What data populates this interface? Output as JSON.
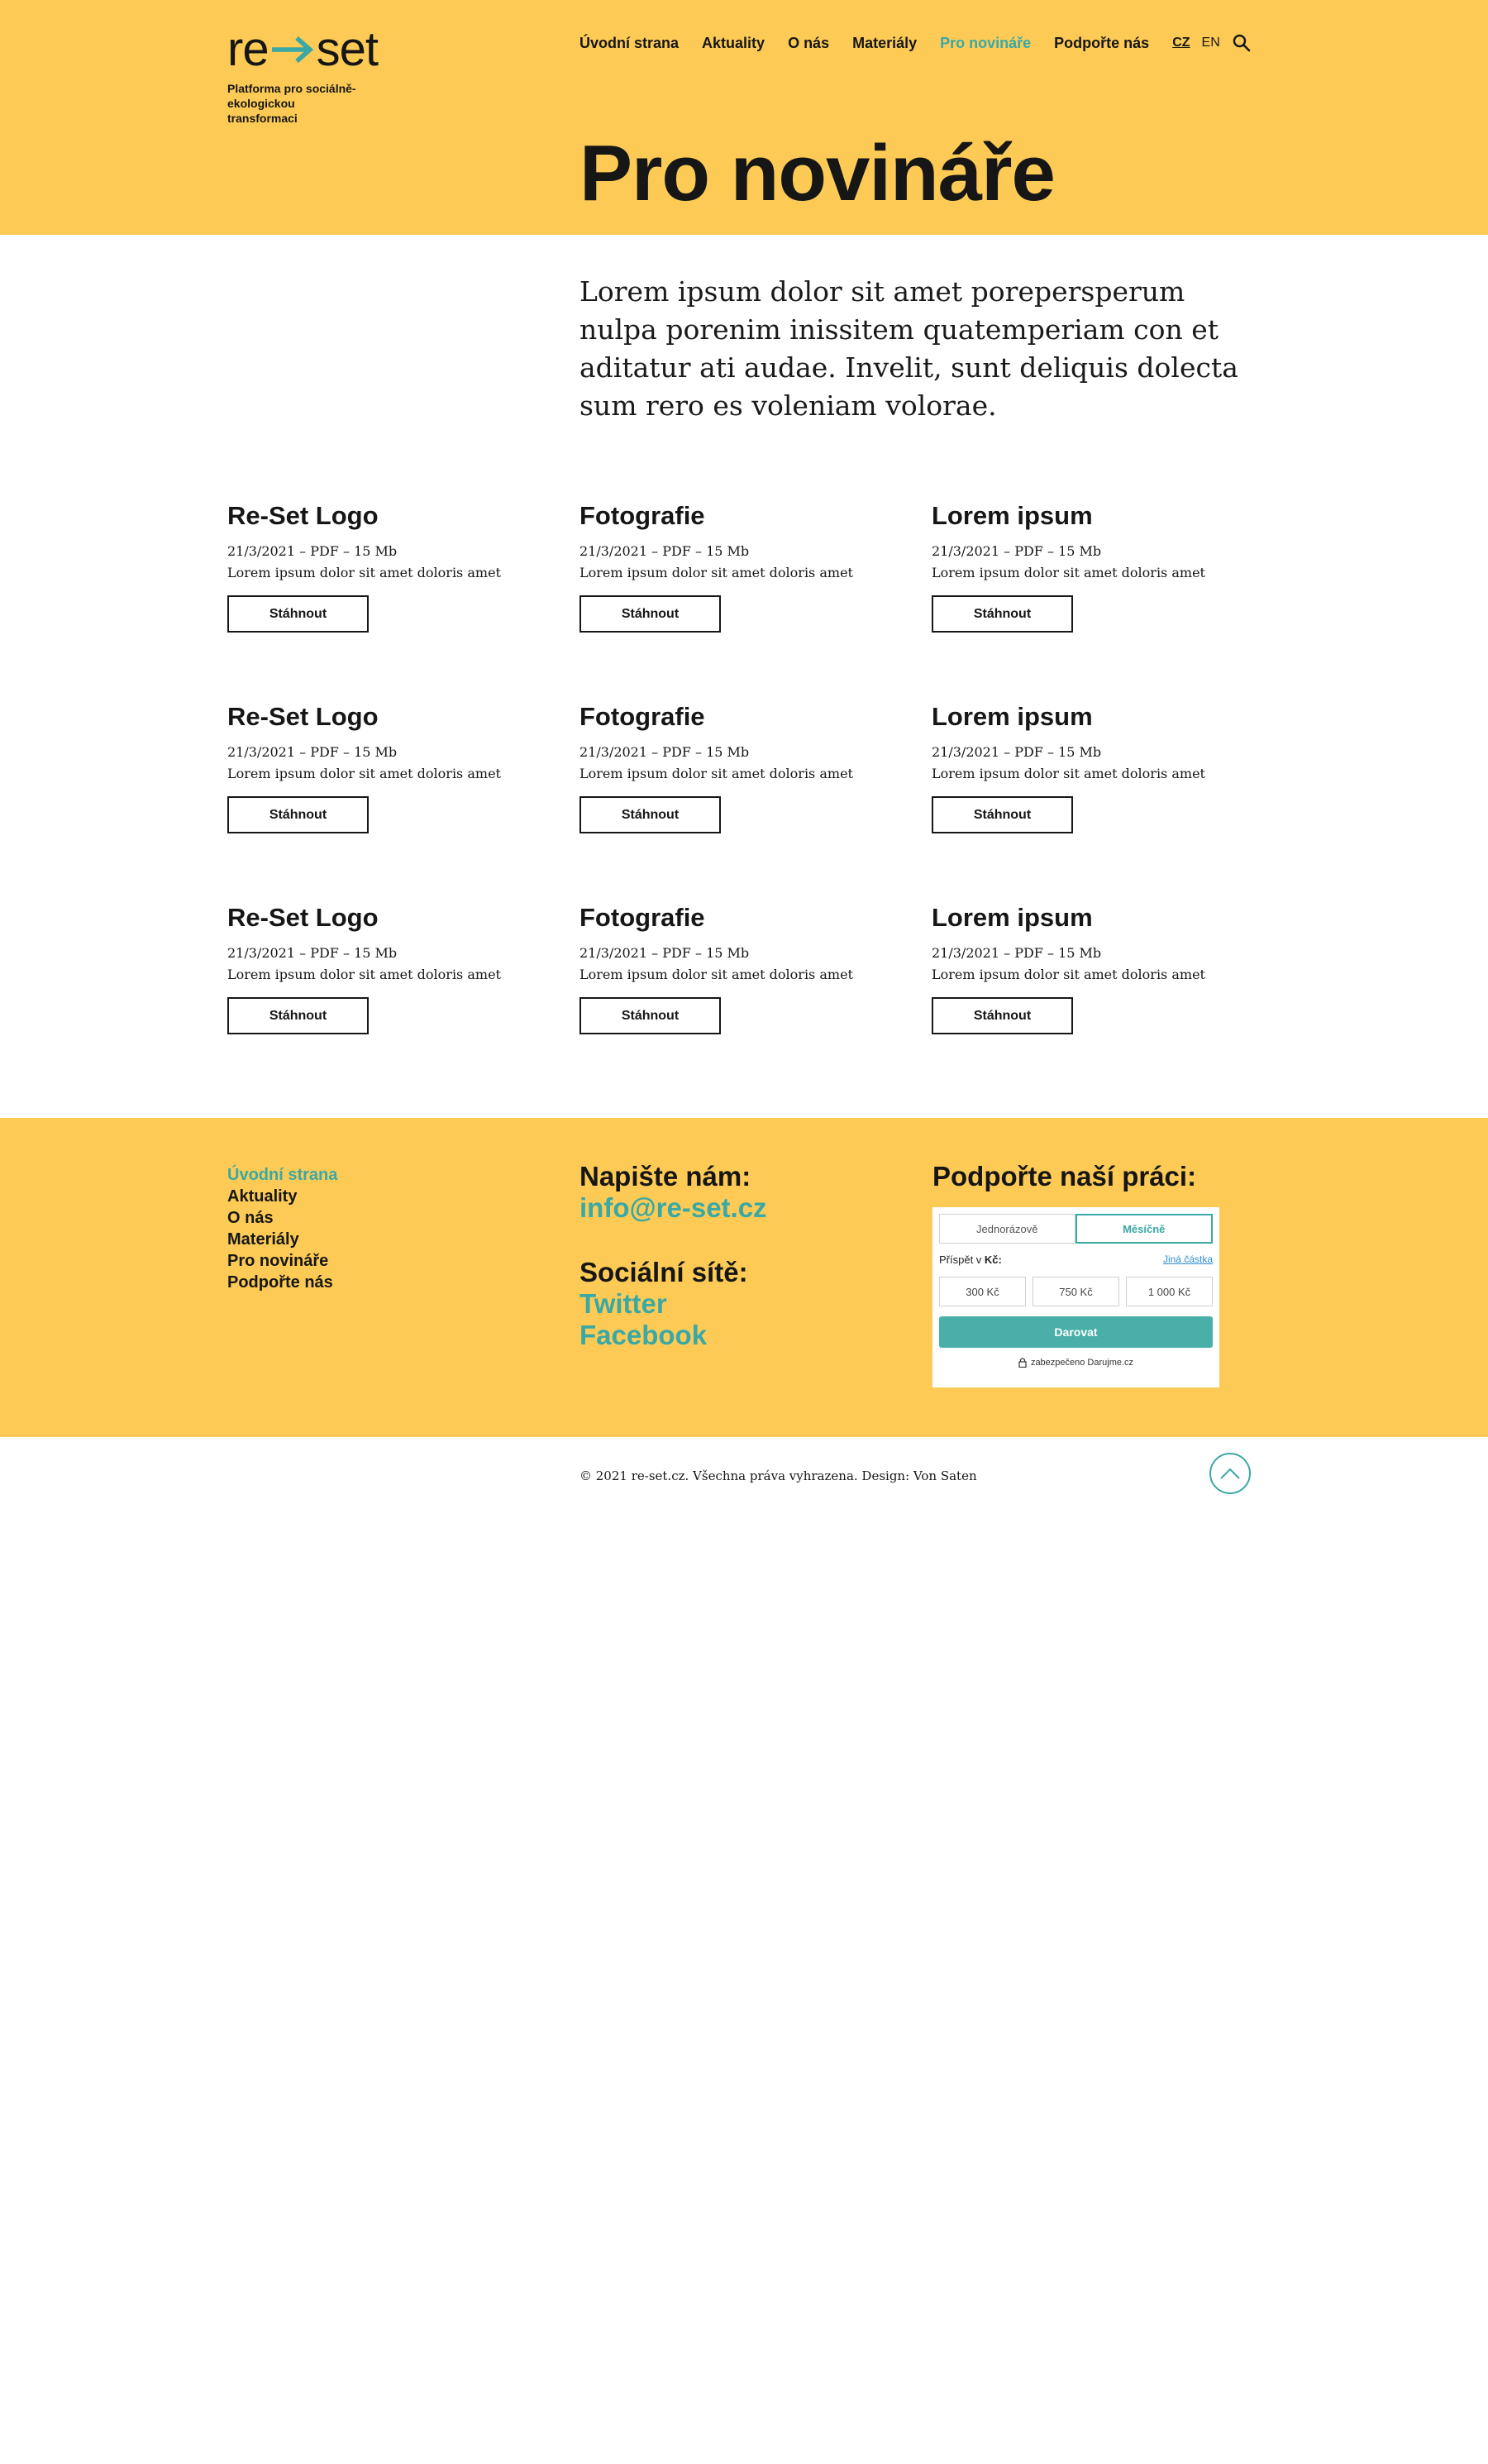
{
  "brand": {
    "logo_left": "re",
    "logo_right": "set",
    "tagline": "Platforma pro sociálně-ekologickou transformaci",
    "accent": "#3aa8a5",
    "yellow": "#fdcb55"
  },
  "nav": {
    "items": [
      {
        "label": "Úvodní strana"
      },
      {
        "label": "Aktuality"
      },
      {
        "label": "O nás"
      },
      {
        "label": "Materiály"
      },
      {
        "label": "Pro novináře",
        "active": true
      },
      {
        "label": "Podpořte nás"
      }
    ],
    "lang_cz": "CZ",
    "lang_en": "EN",
    "search_icon": "search-icon"
  },
  "page": {
    "title": "Pro novináře",
    "intro": "Lorem ipsum dolor sit amet porepersperum nulpa porenim inissitem quatemperiam con et aditatur ati audae. Invelit, sunt deliquis dolecta sum rero es voleniam volorae."
  },
  "downloads": [
    {
      "title": "Re-Set Logo",
      "meta": "21/3/2021 – PDF – 15 Mb",
      "desc": "Lorem ipsum dolor sit amet doloris amet",
      "button": "Stáhnout"
    },
    {
      "title": "Fotografie",
      "meta": "21/3/2021 – PDF – 15 Mb",
      "desc": "Lorem ipsum dolor sit amet doloris amet",
      "button": "Stáhnout"
    },
    {
      "title": "Lorem ipsum",
      "meta": "21/3/2021 – PDF – 15 Mb",
      "desc": "Lorem ipsum dolor sit amet doloris amet",
      "button": "Stáhnout"
    },
    {
      "title": "Re-Set Logo",
      "meta": "21/3/2021 – PDF – 15 Mb",
      "desc": "Lorem ipsum dolor sit amet doloris amet",
      "button": "Stáhnout"
    },
    {
      "title": "Fotografie",
      "meta": "21/3/2021 – PDF – 15 Mb",
      "desc": "Lorem ipsum dolor sit amet doloris amet",
      "button": "Stáhnout"
    },
    {
      "title": "Lorem ipsum",
      "meta": "21/3/2021 – PDF – 15 Mb",
      "desc": "Lorem ipsum dolor sit amet doloris amet",
      "button": "Stáhnout"
    },
    {
      "title": "Re-Set Logo",
      "meta": "21/3/2021 – PDF – 15 Mb",
      "desc": "Lorem ipsum dolor sit amet doloris amet",
      "button": "Stáhnout"
    },
    {
      "title": "Fotografie",
      "meta": "21/3/2021 – PDF – 15 Mb",
      "desc": "Lorem ipsum dolor sit amet doloris amet",
      "button": "Stáhnout"
    },
    {
      "title": "Lorem ipsum",
      "meta": "21/3/2021 – PDF – 15 Mb",
      "desc": "Lorem ipsum dolor sit amet doloris amet",
      "button": "Stáhnout"
    }
  ],
  "footer": {
    "links": [
      {
        "label": "Úvodní strana",
        "active": true
      },
      {
        "label": "Aktuality"
      },
      {
        "label": "O nás"
      },
      {
        "label": "Materiály"
      },
      {
        "label": "Pro novináře"
      },
      {
        "label": "Podpořte nás"
      }
    ],
    "contact_heading": "Napište nám:",
    "email": "info@re-set.cz",
    "social_heading": "Sociální sítě:",
    "social": [
      "Twitter",
      "Facebook"
    ],
    "support_heading": "Podpořte naší práci:",
    "widget": {
      "tab_once": "Jednorázově",
      "tab_monthly": "Měsíčně",
      "contribution_label": "Příspět v",
      "currency": "Kč:",
      "other_amount": "Jiná částka",
      "amounts": [
        "300 Kč",
        "750 Kč",
        "1 000 Kč"
      ],
      "donate": "Darovat",
      "secured": "zabezpečeno Darujme.cz"
    }
  },
  "bottom": {
    "copyright": "© 2021 re-set.cz. Všechna práva vyhrazena. Design: Von Saten"
  }
}
